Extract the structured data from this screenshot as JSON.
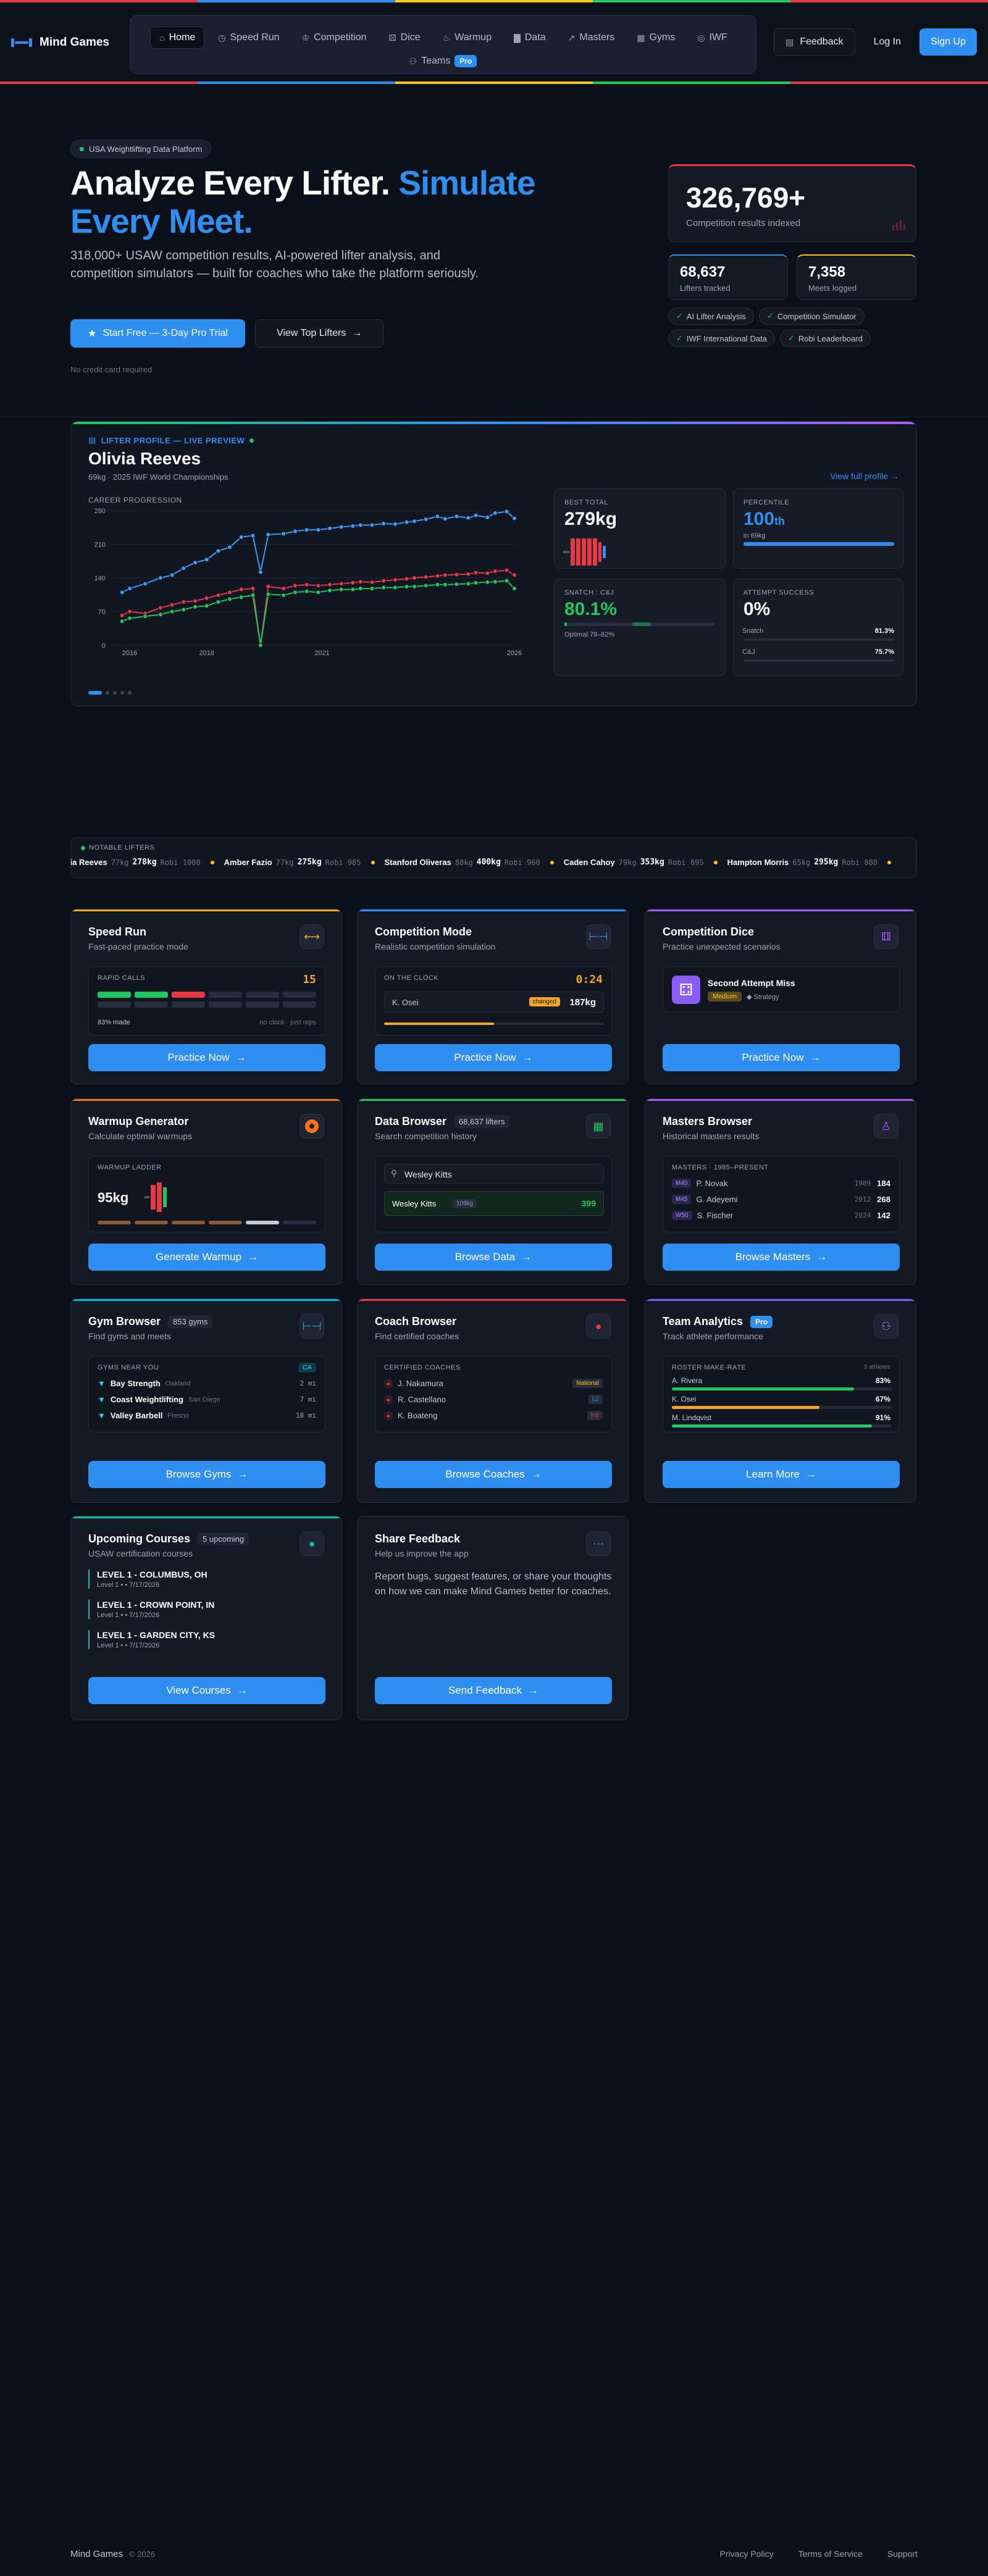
{
  "colors": {
    "accent": "#2f8ff0",
    "red": "#e53946",
    "green": "#22c55e",
    "yellow": "#f5c518"
  },
  "header": {
    "brand": "Mind Games",
    "nav_row1": [
      {
        "label": "Home",
        "icon": "home-icon"
      },
      {
        "label": "Speed Run",
        "icon": "timer-icon"
      },
      {
        "label": "Competition",
        "icon": "trophy-icon"
      },
      {
        "label": "Dice",
        "icon": "dice-icon"
      },
      {
        "label": "Warmup",
        "icon": "flame-icon"
      },
      {
        "label": "Data",
        "icon": "bar-chart-icon"
      },
      {
        "label": "Masters",
        "icon": "trend-icon"
      },
      {
        "label": "Gyms",
        "icon": "building-icon"
      },
      {
        "label": "IWF",
        "icon": "globe-icon"
      }
    ],
    "nav_row2": {
      "label": "Teams",
      "badge": "Pro"
    },
    "feedback": "Feedback",
    "login": "Log In",
    "signup": "Sign Up"
  },
  "hero": {
    "pill": "USA Weightlifting Data Platform",
    "title_white": "Analyze Every Lifter.",
    "title_blue": "Simulate Every Meet.",
    "subtitle": "318,000+ USAW competition results, AI-powered lifter analysis, and competition simulators — built for coaches who take the platform seriously.",
    "cta_primary": "Start Free — 3-Day Pro Trial",
    "cta_secondary": "View Top Lifters",
    "note": "No credit card required",
    "stat_big": {
      "value": "326,769+",
      "label": "Competition results indexed"
    },
    "stat_a": {
      "value": "68,637",
      "label": "Lifters tracked"
    },
    "stat_b": {
      "value": "7,358",
      "label": "Meets logged"
    },
    "chips": [
      "AI Lifter Analysis",
      "Competition Simulator",
      "IWF International Data",
      "Robi Leaderboard"
    ]
  },
  "preview": {
    "tag": "LIFTER PROFILE — LIVE PREVIEW",
    "name": "Olivia Reeves",
    "sub": "69kg · 2025 IWF World Championships",
    "link": "View full profile",
    "chart_label": "CAREER PROGRESSION",
    "best_total": {
      "label": "BEST TOTAL",
      "value": "279kg"
    },
    "percentile": {
      "label": "PERCENTILE",
      "value": "100",
      "suffix": "th",
      "note": "in 69kg",
      "fill": 1.0
    },
    "ratio": {
      "label": "SNATCH : C&J",
      "value": "80.1%",
      "note": "Optimal 78–82%"
    },
    "attempt": {
      "label": "ATTEMPT SUCCESS",
      "value": "0%",
      "snatch_label": "Snatch",
      "snatch_val": "81.3%",
      "snatch_fill": 0.813,
      "cj_label": "C&J",
      "cj_val": "75.7%",
      "cj_fill": 0.757
    }
  },
  "chart_data": {
    "type": "line",
    "title": "CAREER PROGRESSION",
    "xlabel": "",
    "ylabel": "",
    "x_ticks": [
      "2016",
      "2018",
      "2021",
      "2026"
    ],
    "y_ticks": [
      0,
      70,
      140,
      210,
      280
    ],
    "ylim": [
      0,
      280
    ],
    "xlim": [
      2015.5,
      2026.0
    ],
    "series": [
      {
        "name": "",
        "color": "#3b9cf5",
        "points": [
          [
            2015.8,
            110
          ],
          [
            2016.0,
            118
          ],
          [
            2016.4,
            128
          ],
          [
            2016.8,
            140
          ],
          [
            2017.1,
            146
          ],
          [
            2017.4,
            160
          ],
          [
            2017.7,
            172
          ],
          [
            2018.0,
            178
          ],
          [
            2018.3,
            196
          ],
          [
            2018.6,
            204
          ],
          [
            2018.9,
            225
          ],
          [
            2019.2,
            228
          ],
          [
            2019.4,
            152
          ],
          [
            2019.6,
            230
          ],
          [
            2020.0,
            232
          ],
          [
            2020.3,
            237
          ],
          [
            2020.6,
            240
          ],
          [
            2020.9,
            240
          ],
          [
            2021.2,
            243
          ],
          [
            2021.5,
            246
          ],
          [
            2021.8,
            248
          ],
          [
            2022.0,
            250
          ],
          [
            2022.3,
            250
          ],
          [
            2022.6,
            253
          ],
          [
            2022.9,
            252
          ],
          [
            2023.2,
            256
          ],
          [
            2023.4,
            258
          ],
          [
            2023.7,
            262
          ],
          [
            2024.0,
            268
          ],
          [
            2024.2,
            263
          ],
          [
            2024.5,
            268
          ],
          [
            2024.8,
            265
          ],
          [
            2025.0,
            270
          ],
          [
            2025.3,
            266
          ],
          [
            2025.5,
            275
          ],
          [
            2025.8,
            278
          ],
          [
            2026.0,
            264
          ]
        ]
      },
      {
        "name": "",
        "color": "#e53946",
        "points": [
          [
            2015.8,
            62
          ],
          [
            2016.0,
            70
          ],
          [
            2016.4,
            66
          ],
          [
            2016.8,
            78
          ],
          [
            2017.1,
            84
          ],
          [
            2017.4,
            90
          ],
          [
            2017.7,
            92
          ],
          [
            2018.0,
            98
          ],
          [
            2018.3,
            104
          ],
          [
            2018.6,
            110
          ],
          [
            2018.9,
            116
          ],
          [
            2019.2,
            118
          ],
          [
            2019.4,
            0
          ],
          [
            2019.6,
            122
          ],
          [
            2020.0,
            118
          ],
          [
            2020.3,
            124
          ],
          [
            2020.6,
            126
          ],
          [
            2020.9,
            124
          ],
          [
            2021.2,
            126
          ],
          [
            2021.5,
            128
          ],
          [
            2021.8,
            130
          ],
          [
            2022.0,
            132
          ],
          [
            2022.3,
            131
          ],
          [
            2022.6,
            134
          ],
          [
            2022.9,
            136
          ],
          [
            2023.2,
            138
          ],
          [
            2023.4,
            140
          ],
          [
            2023.7,
            142
          ],
          [
            2024.0,
            144
          ],
          [
            2024.2,
            146
          ],
          [
            2024.5,
            147
          ],
          [
            2024.8,
            148
          ],
          [
            2025.0,
            151
          ],
          [
            2025.3,
            150
          ],
          [
            2025.5,
            154
          ],
          [
            2025.8,
            156
          ],
          [
            2026.0,
            146
          ]
        ]
      },
      {
        "name": "",
        "color": "#22c55e",
        "points": [
          [
            2015.8,
            50
          ],
          [
            2016.0,
            56
          ],
          [
            2016.4,
            60
          ],
          [
            2016.8,
            64
          ],
          [
            2017.1,
            70
          ],
          [
            2017.4,
            74
          ],
          [
            2017.7,
            80
          ],
          [
            2018.0,
            82
          ],
          [
            2018.3,
            90
          ],
          [
            2018.6,
            96
          ],
          [
            2018.9,
            100
          ],
          [
            2019.2,
            104
          ],
          [
            2019.4,
            0
          ],
          [
            2019.6,
            106
          ],
          [
            2020.0,
            104
          ],
          [
            2020.3,
            110
          ],
          [
            2020.6,
            112
          ],
          [
            2020.9,
            110
          ],
          [
            2021.2,
            114
          ],
          [
            2021.5,
            116
          ],
          [
            2021.8,
            116
          ],
          [
            2022.0,
            118
          ],
          [
            2022.3,
            118
          ],
          [
            2022.6,
            120
          ],
          [
            2022.9,
            120
          ],
          [
            2023.2,
            122
          ],
          [
            2023.4,
            122
          ],
          [
            2023.7,
            124
          ],
          [
            2024.0,
            126
          ],
          [
            2024.2,
            126
          ],
          [
            2024.5,
            127
          ],
          [
            2024.8,
            128
          ],
          [
            2025.0,
            130
          ],
          [
            2025.3,
            131
          ],
          [
            2025.5,
            132
          ],
          [
            2025.8,
            134
          ],
          [
            2026.0,
            118
          ]
        ]
      }
    ]
  },
  "ticker": {
    "label": "NOTABLE LIFTERS",
    "items": [
      {
        "name": "Olivia Reeves",
        "cls": "77kg",
        "total": "278kg",
        "robi": "Robi 1000"
      },
      {
        "name": "Amber Fazio",
        "cls": "77kg",
        "total": "275kg",
        "robi": "Robi 985"
      },
      {
        "name": "Stanford Oliveras",
        "cls": "88kg",
        "total": "400kg",
        "robi": "Robi 960"
      },
      {
        "name": "Caden Cahoy",
        "cls": "79kg",
        "total": "353kg",
        "robi": "Robi 895"
      },
      {
        "name": "Hampton Morris",
        "cls": "65kg",
        "total": "295kg",
        "robi": "Robi 880"
      }
    ]
  },
  "cards": {
    "speed": {
      "title": "Speed Run",
      "sub": "Fast-paced practice mode",
      "inner_label": "RAPID CALLS",
      "count": "15",
      "foot_left": "83% made",
      "foot_right": "no clock · just reps",
      "cta": "Practice Now"
    },
    "comp": {
      "title": "Competition Mode",
      "sub": "Realistic competition simulation",
      "inner_label": "ON THE CLOCK",
      "clock": "0:24",
      "lifter": "K. Osei",
      "tag": "changed",
      "weight": "187kg",
      "cta": "Practice Now"
    },
    "dice": {
      "title": "Competition Dice",
      "sub": "Practice unexpected scenarios",
      "scenario": "Second Attempt Miss",
      "difficulty": "Medium",
      "kind": "Strategy",
      "cta": "Practice Now"
    },
    "warmup": {
      "title": "Warmup Generator",
      "sub": "Calculate optimal warmups",
      "inner_label": "WARMUP LADDER",
      "weight": "95kg",
      "cta": "Generate Warmup"
    },
    "data": {
      "title": "Data Browser",
      "count": "68,637 lifters",
      "sub": "Search competition history",
      "search": "Wesley Kitts",
      "result_name": "Wesley Kitts",
      "result_cls": "109kg",
      "result_val": "399",
      "cta": "Browse Data"
    },
    "masters": {
      "title": "Masters Browser",
      "sub": "Historical masters results",
      "inner_label": "MASTERS · 1985–PRESENT",
      "rows": [
        {
          "tag": "M40",
          "name": "P. Novak",
          "year": "1989",
          "val": "184"
        },
        {
          "tag": "M45",
          "name": "G. Adeyemi",
          "year": "2012",
          "val": "268"
        },
        {
          "tag": "W50",
          "name": "S. Fischer",
          "year": "2024",
          "val": "142"
        }
      ],
      "cta": "Browse Masters"
    },
    "gym": {
      "title": "Gym Browser",
      "count": "853 gyms",
      "sub": "Find gyms and meets",
      "inner_label": "GYMS NEAR YOU",
      "state": "CA",
      "rows": [
        {
          "name": "Bay Strength",
          "city": "Oakland",
          "dist": "2 mi"
        },
        {
          "name": "Coast Weightlifting",
          "city": "San Diego",
          "dist": "7 mi"
        },
        {
          "name": "Valley Barbell",
          "city": "Fresno",
          "dist": "18 mi"
        }
      ],
      "cta": "Browse Gyms"
    },
    "coach": {
      "title": "Coach Browser",
      "sub": "Find certified coaches",
      "inner_label": "CERTIFIED COACHES",
      "rows": [
        {
          "name": "J. Nakamura",
          "level": "National"
        },
        {
          "name": "R. Castellano",
          "level": "L2"
        },
        {
          "name": "K. Boateng",
          "level": "Intl"
        }
      ],
      "cta": "Browse Coaches"
    },
    "team": {
      "title": "Team Analytics",
      "badge": "Pro",
      "sub": "Track athlete performance",
      "inner_label": "ROSTER MAKE-RATE",
      "inner_right": "3 athletes",
      "rows": [
        {
          "name": "A. Rivera",
          "val": "83%",
          "fill": 0.83,
          "color": "#22c55e"
        },
        {
          "name": "K. Osei",
          "val": "67%",
          "fill": 0.67,
          "color": "#f5a524"
        },
        {
          "name": "M. Lindqvist",
          "val": "91%",
          "fill": 0.91,
          "color": "#22c55e"
        }
      ],
      "cta": "Learn More"
    },
    "courses": {
      "title": "Upcoming Courses",
      "count": "5 upcoming",
      "sub": "USAW certification courses",
      "rows": [
        {
          "name": "LEVEL 1 - COLUMBUS, OH",
          "meta": "Level 1 • • 7/17/2026"
        },
        {
          "name": "LEVEL 1 - CROWN POINT, IN",
          "meta": "Level 1 • • 7/17/2026"
        },
        {
          "name": "LEVEL 1 - GARDEN CITY, KS",
          "meta": "Level 1 • • 7/17/2026"
        }
      ],
      "cta": "View Courses"
    },
    "feedback": {
      "title": "Share Feedback",
      "sub": "Help us improve the app",
      "body": "Report bugs, suggest features, or share your thoughts on how we can make Mind Games better for coaches.",
      "cta": "Send Feedback"
    }
  },
  "footer": {
    "brand": "Mind Games",
    "copy": "© 2026",
    "links": [
      "Privacy Policy",
      "Terms of Service",
      "Support"
    ]
  }
}
